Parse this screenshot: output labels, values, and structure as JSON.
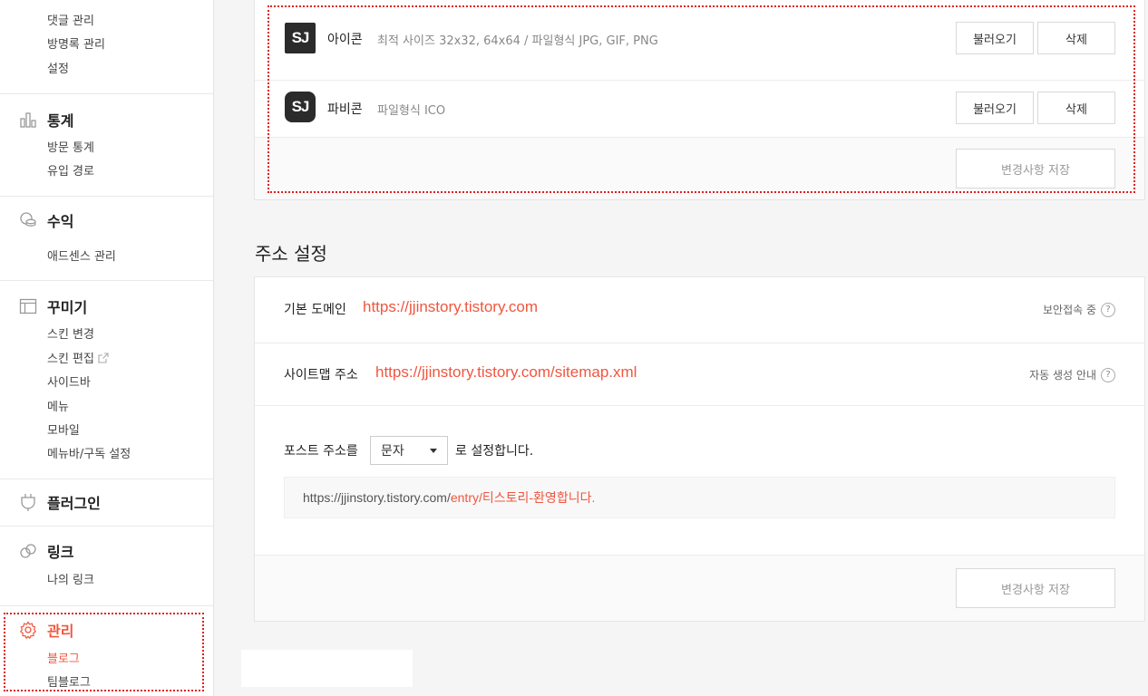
{
  "sidebar": {
    "top_items": [
      "댓글 관리",
      "방명록 관리",
      "설정"
    ],
    "groups": [
      {
        "title": "통계",
        "icon": "bar-chart-icon",
        "items": [
          "방문 통계",
          "유입 경로"
        ]
      },
      {
        "title": "수익",
        "icon": "coins-icon",
        "items": [
          "애드센스 관리"
        ]
      },
      {
        "title": "꾸미기",
        "icon": "layout-icon",
        "items": [
          "스킨 변경",
          "스킨 편집",
          "사이드바",
          "메뉴",
          "모바일",
          "메뉴바/구독 설정"
        ]
      },
      {
        "title": "플러그인",
        "icon": "plug-icon",
        "items": []
      },
      {
        "title": "링크",
        "icon": "link-icon",
        "items": [
          "나의 링크"
        ]
      },
      {
        "title": "관리",
        "icon": "gear-icon",
        "items": [
          "블로그",
          "팀블로그"
        ],
        "active_item": "블로그"
      }
    ]
  },
  "icon_section": {
    "rows": [
      {
        "logo_text": "SJ",
        "label": "아이콘",
        "hint": "최적 사이즈 32x32, 64x64 / 파일형식 JPG, GIF, PNG",
        "load_label": "불러오기",
        "delete_label": "삭제"
      },
      {
        "logo_text": "SJ",
        "label": "파비콘",
        "hint": "파일형식 ICO",
        "load_label": "불러오기",
        "delete_label": "삭제"
      }
    ],
    "save_label": "변경사항 저장"
  },
  "address_section": {
    "title": "주소 설정",
    "domain_label": "기본 도메인",
    "domain_url": "https://jjinstory.tistory.com",
    "domain_help": "보안접속 중",
    "sitemap_label": "사이트맵 주소",
    "sitemap_url": "https://jjinstory.tistory.com/sitemap.xml",
    "sitemap_help": "자동 생성 안내",
    "post_prefix": "포스트 주소를",
    "post_select": "문자",
    "post_suffix": "로 설정합니다.",
    "preview_base": "https://jjinstory.tistory.com/",
    "preview_path": "entry/티스토리-환영합니다.",
    "save_label": "변경사항 저장"
  },
  "colors": {
    "accent": "#f0563f",
    "highlight_border": "#dd2222"
  }
}
